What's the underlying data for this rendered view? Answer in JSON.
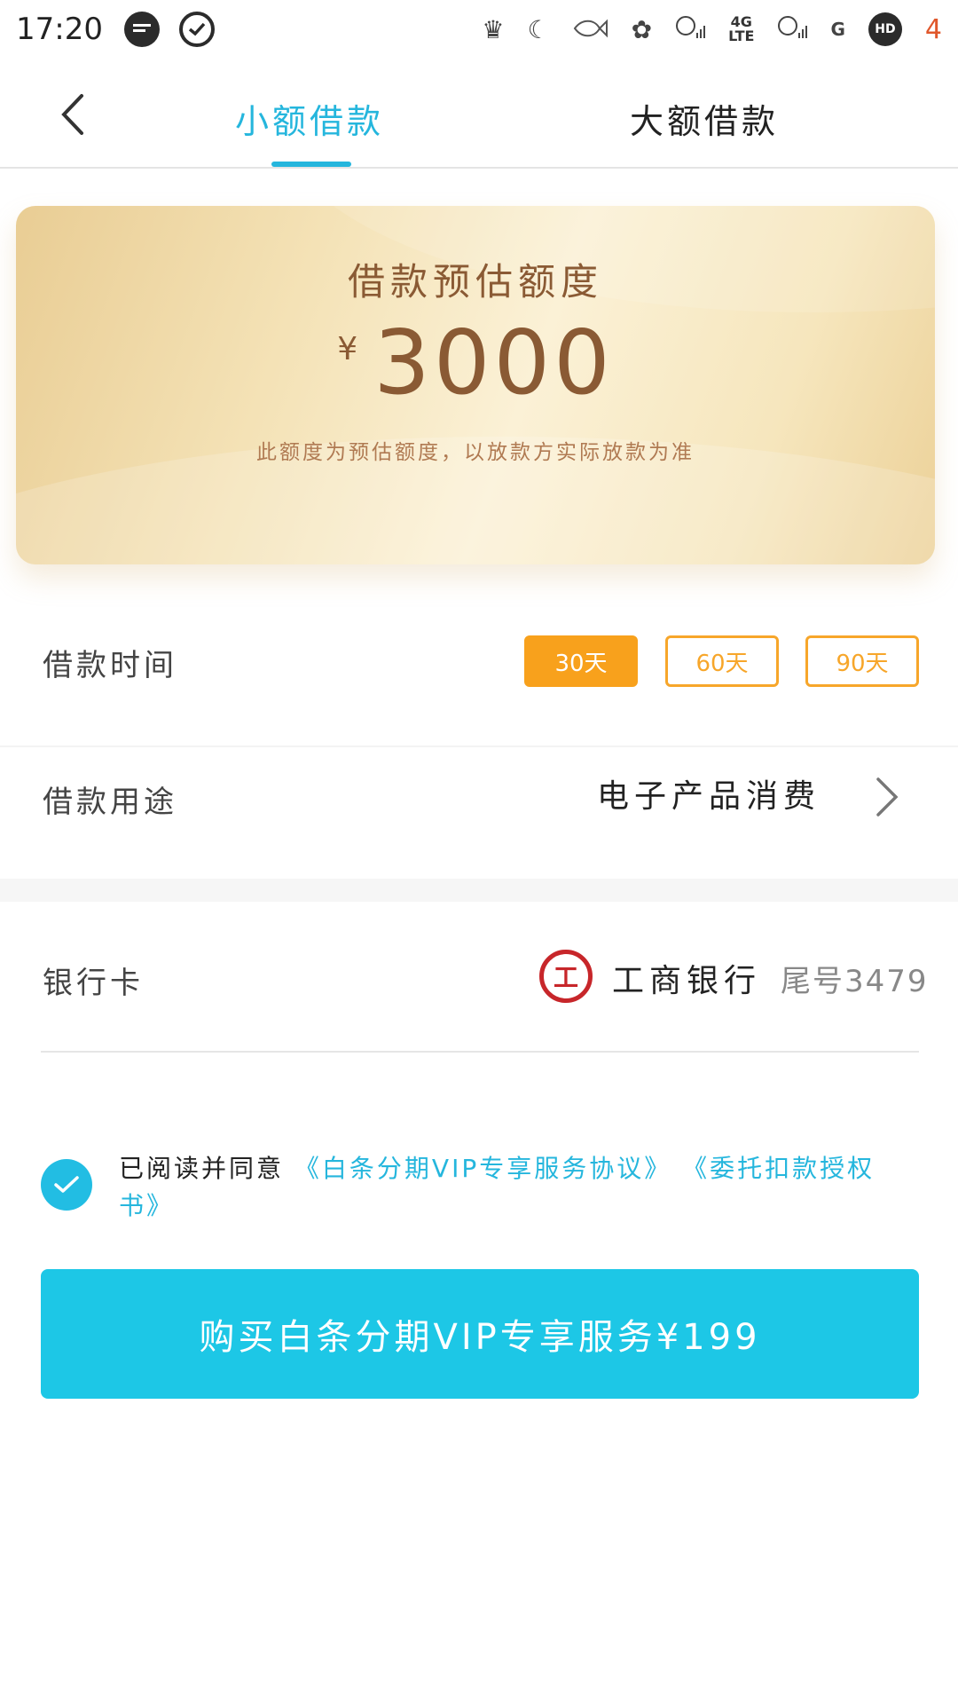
{
  "status_bar": {
    "time": "17:20",
    "network_label": "4G",
    "network_sub": "LTE",
    "signal_g": "G",
    "hd_label": "HD",
    "battery": "4",
    "icons": [
      "message-bubble-icon",
      "check-circle-icon",
      "crown-icon",
      "moon-icon",
      "fish-icon",
      "flower-icon",
      "signal-icon",
      "hd-icon",
      "battery-icon"
    ]
  },
  "nav": {
    "tab_small": "小额借款",
    "tab_large": "大额借款",
    "active_tab": "小额借款"
  },
  "card": {
    "title": "借款预估额度",
    "currency": "¥",
    "amount": "3000",
    "note": "此额度为预估额度，以放款方实际放款为准"
  },
  "loan_term": {
    "label": "借款时间",
    "options": [
      "30天",
      "60天",
      "90天"
    ],
    "selected": "30天"
  },
  "loan_purpose": {
    "label": "借款用途",
    "value": "电子产品消费"
  },
  "bank": {
    "label": "银行卡",
    "logo_glyph": "工",
    "name": "工商银行",
    "tail": "尾号3479"
  },
  "agreement": {
    "checked": true,
    "prefix": "已阅读并同意",
    "link1": "《白条分期VIP专享服务协议》",
    "link2": "《委托扣款授权书》"
  },
  "buy_button": {
    "label": "购买白条分期VIP专享服务¥199"
  },
  "colors": {
    "accent": "#25b6dd",
    "button": "#1dc7e6",
    "orange": "#f8a11c",
    "card_text": "#8a5a34",
    "bank_red": "#c7262a"
  }
}
